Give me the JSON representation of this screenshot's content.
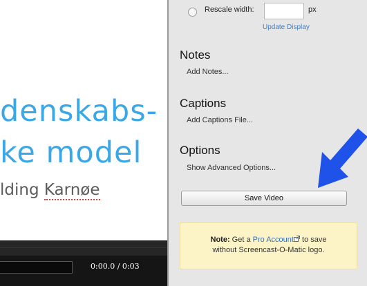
{
  "preview": {
    "slide_line_1": "denskabs-",
    "slide_line_2": "ke model",
    "slide_line_3_prefix": "lding ",
    "slide_line_3_name": "Karnøe",
    "timecode": "0:00.0 / 0:03"
  },
  "panel": {
    "rescale_label": "Rescale width:",
    "rescale_value": "",
    "px_label": "px",
    "update_display": "Update Display",
    "notes_title": "Notes",
    "notes_link": "Add Notes...",
    "captions_title": "Captions",
    "captions_link": "Add Captions File...",
    "options_title": "Options",
    "options_link": "Show Advanced Options...",
    "save_button": "Save Video",
    "note_label": "Note:",
    "note_text_1": "Get a",
    "pro_account_link": "Pro Account",
    "note_text_2": "to save",
    "note_text_3": "without Screencast-O-Matic logo."
  },
  "colors": {
    "slide_title": "#3aa8e6",
    "arrow": "#1f52e8",
    "note_background": "#fcf3c7",
    "link": "#3b7fd0"
  }
}
